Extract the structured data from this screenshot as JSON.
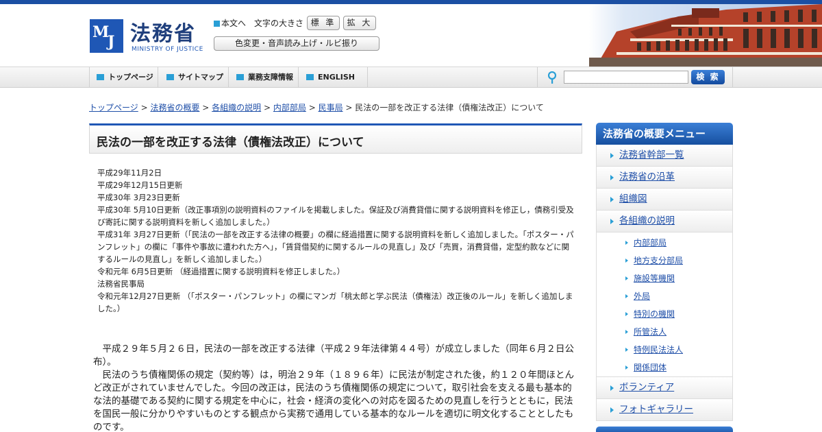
{
  "header": {
    "logo_mark_m": "M",
    "logo_mark_j": "J",
    "title": "法務省",
    "subtitle": "MINISTRY OF JUSTICE",
    "skip_link": "本文へ",
    "fontsize_label": "文字の大きさ",
    "fontsize_standard": "標 準",
    "fontsize_large": "拡 大",
    "accessibility": "色変更・音声読み上げ・ルビ振り"
  },
  "nav": {
    "home": "トップページ",
    "sitemap": "サイトマップ",
    "business": "業務支障情報",
    "english": "ENGLISH",
    "search_value": "",
    "search_button": "検 索"
  },
  "breadcrumb": {
    "items": [
      "トップページ",
      "法務省の概要",
      "各組織の説明",
      "内部部局",
      "民事局"
    ],
    "separator": " > ",
    "current": "民法の一部を改正する法律（債権法改正）について"
  },
  "main": {
    "title": "民法の一部を改正する法律（債権法改正）について",
    "updates": [
      "平成29年11月2日",
      "平成29年12月15日更新",
      "平成30年  3月23日更新",
      "平成30年  5月10日更新（改正事項別の説明資料のファイルを掲載しました。保証及び消費貸借に関する説明資料を修正し，債務引受及び寄託に関する説明資料を新しく追加しました。）",
      "平成31年  3月27日更新（「民法の一部を改正する法律の概要」の欄に経過措置に関する説明資料を新しく追加しました。「ポスター・パンフレット」の欄に「事件や事故に遭われた方へ」，「賃貸借契約に関するルールの見直し」及び「売買，消費貸借，定型約款などに関するルールの見直し」を新しく追加しました。）",
      "令和元年  6月5日更新  （経過措置に関する説明資料を修正しました。）",
      "法務省民事局",
      "令和元年12月27日更新    （「ポスター・パンフレット」の欄にマンガ「桃太郎と学ぶ民法（債権法）改正後のルール」を新しく追加しました。）"
    ],
    "paragraphs": [
      "　平成２９年５月２６日，民法の一部を改正する法律（平成２９年法律第４４号）が成立しました（同年６月２日公布）。",
      "　民法のうち債権関係の規定（契約等）は，明治２９年（１８９６年）に民法が制定された後，約１２０年間ほとんど改正がされていませんでした。今回の改正は，民法のうち債権関係の規定について，取引社会を支える最も基本的な法的基礎である契約に関する規定を中心に，社会・経済の変化への対応を図るための見直しを行うとともに，民法を国民一般に分かりやすいものとする観点から実務で通用している基本的なルールを適切に明文化することとしたものです。"
    ]
  },
  "sidebar": {
    "title": "法務省の概要メニュー",
    "items": [
      "法務省幹部一覧",
      "法務省の沿革",
      "組織図",
      "各組織の説明"
    ],
    "subitems": [
      "内部部局",
      "地方支分部局",
      "施設等機関",
      "外局",
      "特別の機関",
      "所管法人",
      "特例民法法人",
      "関係団体"
    ],
    "items_after": [
      "ボランティア",
      "フォトギャラリー"
    ]
  },
  "colors": {
    "brand_blue": "#1f57b5",
    "link_blue": "#1f4fa8",
    "accent_cyan": "#2a9fd6",
    "brick": "#b5422a"
  }
}
